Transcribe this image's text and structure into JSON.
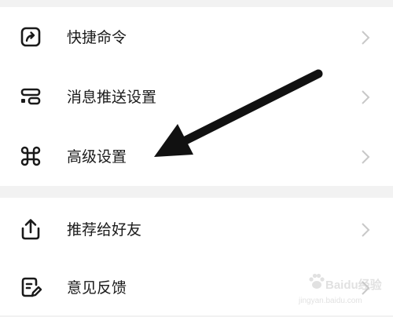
{
  "menu": {
    "group1": [
      {
        "label": "快捷命令",
        "icon": "shortcut-arrow-icon"
      },
      {
        "label": "消息推送设置",
        "icon": "message-push-icon"
      },
      {
        "label": "高级设置",
        "icon": "command-key-icon"
      }
    ],
    "group2": [
      {
        "label": "推荐给好友",
        "icon": "share-upload-icon"
      },
      {
        "label": "意见反馈",
        "icon": "feedback-edit-icon"
      }
    ]
  },
  "watermark": {
    "brand": "Baidu经验",
    "url": "jingyan.baidu.com"
  },
  "colors": {
    "background": "#f2f2f2",
    "card": "#ffffff",
    "text": "#1a1a1a",
    "chevron": "#c8c8c8",
    "annotation_arrow": "#111111"
  }
}
